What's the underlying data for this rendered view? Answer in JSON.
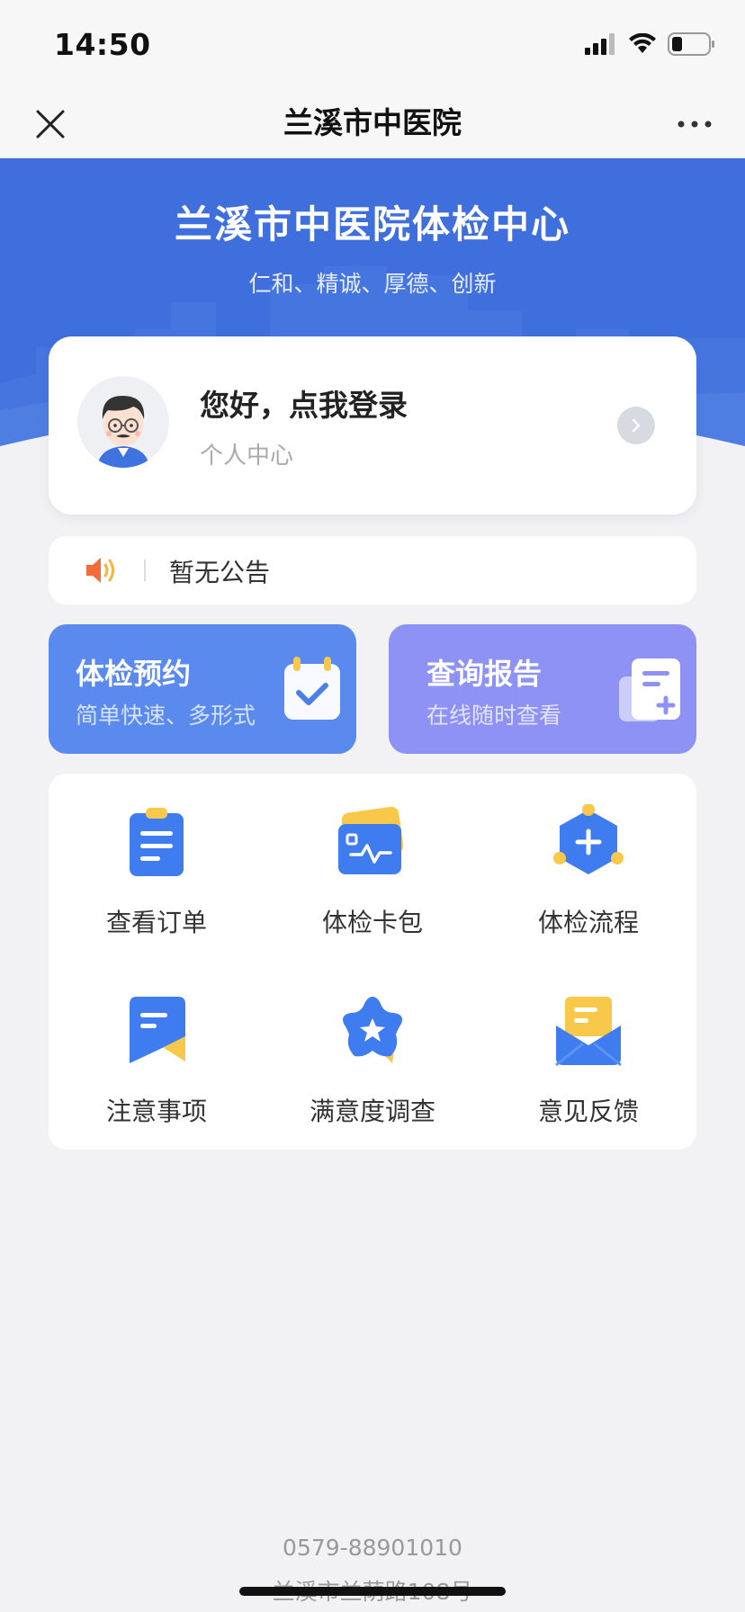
{
  "status_bar": {
    "time": "14:50"
  },
  "nav": {
    "title": "兰溪市中医院",
    "close_icon": "close-icon",
    "more_icon": "more-dots-icon"
  },
  "hero": {
    "title": "兰溪市中医院体检中心",
    "subtitle": "仁和、精诚、厚德、创新",
    "background_color": "#3f6fdc"
  },
  "login": {
    "title": "您好，点我登录",
    "subtitle": "个人中心",
    "avatar_icon": "user-avatar-icon"
  },
  "notice": {
    "text": "暂无公告",
    "icon": "speaker-icon"
  },
  "actions": [
    {
      "title": "体检预约",
      "subtitle": "简单快速、多形式",
      "color": "#5b8aee",
      "icon": "calendar-check-icon"
    },
    {
      "title": "查询报告",
      "subtitle": "在线随时查看",
      "color": "#8d92f4",
      "icon": "report-document-icon"
    }
  ],
  "grid": [
    {
      "label": "查看订单",
      "icon": "clipboard-icon"
    },
    {
      "label": "体检卡包",
      "icon": "card-wallet-icon"
    },
    {
      "label": "体检流程",
      "icon": "hexagon-plus-icon"
    },
    {
      "label": "注意事项",
      "icon": "bookmark-note-icon"
    },
    {
      "label": "满意度调查",
      "icon": "star-badge-icon"
    },
    {
      "label": "意见反馈",
      "icon": "envelope-icon"
    }
  ],
  "footer": {
    "phone": "0579-88901010",
    "address": "兰溪市兰荫路108号"
  }
}
